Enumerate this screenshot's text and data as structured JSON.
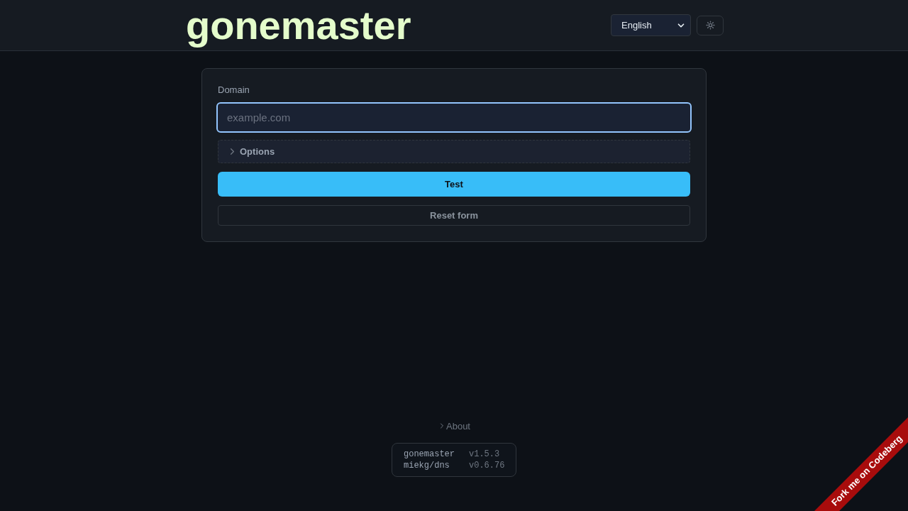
{
  "header": {
    "logo": "gonemaster",
    "language_select": {
      "value": "English"
    }
  },
  "form": {
    "domain": {
      "label": "Domain",
      "placeholder": "example.com",
      "focused": true
    },
    "options": {
      "label": "Options",
      "expanded": false
    },
    "test_button": "Test",
    "reset_button": "Reset form"
  },
  "footer": {
    "about": {
      "label": "About",
      "expanded": false
    },
    "versions": [
      {
        "name": "gonemaster",
        "version": "v1.5.3"
      },
      {
        "name": "miekg/dns",
        "version": "v0.6.76"
      }
    ]
  },
  "ribbon": {
    "label": "Fork me on Codeberg"
  }
}
